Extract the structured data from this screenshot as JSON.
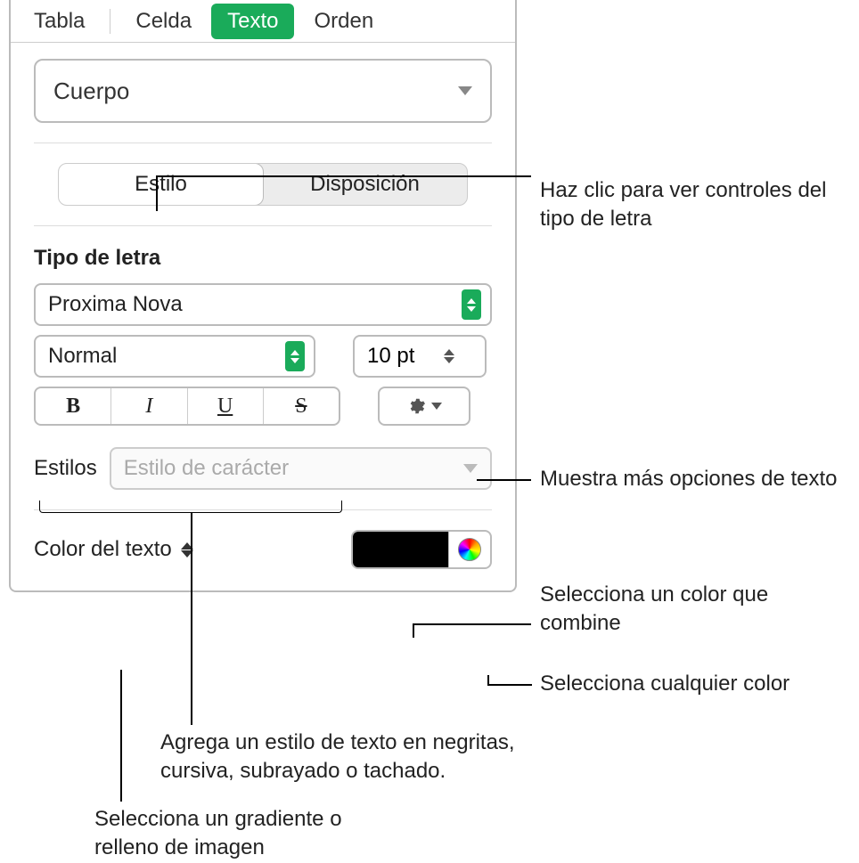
{
  "top_tabs": {
    "tabla": "Tabla",
    "celda": "Celda",
    "texto": "Texto",
    "orden": "Orden"
  },
  "paragraph_style": "Cuerpo",
  "segmented": {
    "estilo": "Estilo",
    "disposicion": "Disposición"
  },
  "font_section": {
    "heading": "Tipo de letra",
    "font_family": "Proxima Nova",
    "font_weight": "Normal",
    "font_size": "10 pt",
    "bold": "B",
    "italic": "I",
    "underline": "U",
    "strike": "S"
  },
  "styles_row": {
    "label": "Estilos",
    "placeholder": "Estilo de carácter"
  },
  "color_row": {
    "label": "Color del texto"
  },
  "callouts": {
    "font_controls": "Haz clic para ver controles del tipo de letra",
    "more_options": "Muestra más opciones de texto",
    "matching_color": "Selecciona un color que combine",
    "any_color": "Selecciona cualquier color",
    "bius": "Agrega un estilo de texto en negritas, cursiva, subrayado o tachado.",
    "gradient": "Selecciona un gradiente o relleno de imagen"
  }
}
